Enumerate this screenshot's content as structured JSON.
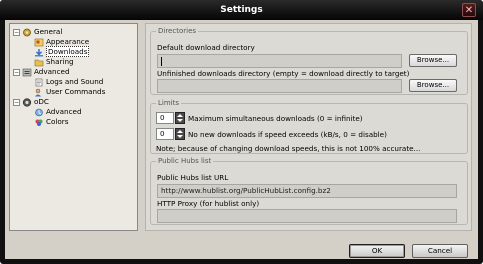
{
  "window": {
    "title": "Settings",
    "close_glyph": "✕"
  },
  "tree": {
    "items": [
      {
        "label": "General",
        "icon": "gear-icon",
        "expander": "−"
      },
      {
        "label": "Appearance",
        "icon": "paint-icon"
      },
      {
        "label": "Downloads",
        "icon": "download-icon",
        "selected": true
      },
      {
        "label": "Sharing",
        "icon": "share-icon"
      },
      {
        "label": "Advanced",
        "icon": "tools-icon",
        "expander": "−"
      },
      {
        "label": "Logs and Sound",
        "icon": "logs-icon"
      },
      {
        "label": "User Commands",
        "icon": "commands-icon"
      },
      {
        "label": "oDC",
        "icon": "odc-icon",
        "expander": "−"
      },
      {
        "label": "Advanced",
        "icon": "advanced-icon"
      },
      {
        "label": "Colors",
        "icon": "colors-icon"
      }
    ]
  },
  "directories": {
    "legend": "Directories",
    "default_label": "Default download directory",
    "default_value": "",
    "unfinished_label": "Unfinished downloads directory (empty = download directly to target)",
    "unfinished_value": "",
    "browse_label": "Browse..."
  },
  "limits": {
    "legend": "Limits",
    "max_value": "0",
    "max_label": "Maximum simultaneous downloads (0 = infinite)",
    "speed_value": "0",
    "speed_label": "No new downloads if speed exceeds (kB/s, 0 = disable)",
    "note": "Note; because of changing download speeds, this is not 100% accurate..."
  },
  "hubs": {
    "legend": "Public Hubs list",
    "url_label": "Public Hubs list URL",
    "url_value": "http://www.hublist.org/PublicHubList.config.bz2",
    "proxy_label": "HTTP Proxy (for hublist only)",
    "proxy_value": ""
  },
  "buttons": {
    "ok": "OK",
    "cancel": "Cancel"
  }
}
